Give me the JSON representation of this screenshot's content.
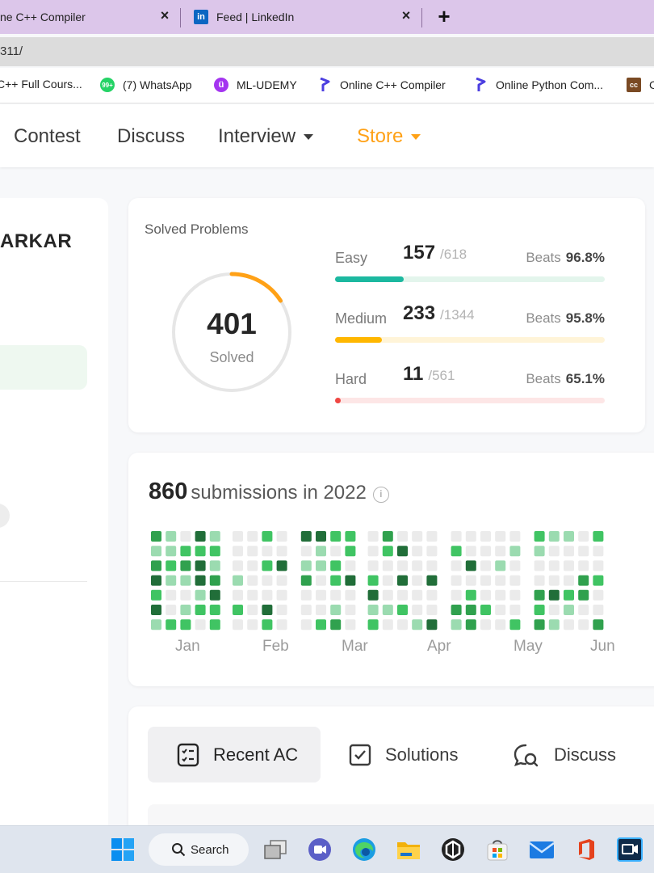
{
  "browser": {
    "tabs": [
      {
        "title": "ne C++ Compiler",
        "close": "×"
      },
      {
        "title": "Feed | LinkedIn",
        "close": "×",
        "icon": "in"
      }
    ],
    "new_tab": "+",
    "url": "311/",
    "bookmarks": [
      {
        "label": "C++ Full Cours..."
      },
      {
        "label": "(7) WhatsApp",
        "badge": "99+"
      },
      {
        "label": "ML-UDEMY",
        "badge": "ü"
      },
      {
        "label": "Online C++ Compiler"
      },
      {
        "label": "Online Python Com..."
      },
      {
        "label": "C",
        "badge": "cc"
      }
    ]
  },
  "nav": {
    "items": [
      {
        "label": "Contest"
      },
      {
        "label": "Discuss"
      },
      {
        "label": "Interview"
      },
      {
        "label": "Store"
      }
    ]
  },
  "profile": {
    "username": "ARKAR"
  },
  "solved": {
    "title": "Solved Problems",
    "total": "401",
    "total_label": "Solved",
    "total_fraction": 0.159,
    "difficulties": [
      {
        "name": "Easy",
        "count": "157",
        "total": "/618",
        "beats_label": "Beats",
        "beats": "96.8%",
        "fraction": 0.254,
        "color": "#1cb8a0",
        "track": "#e3f5ec"
      },
      {
        "name": "Medium",
        "count": "233",
        "total": "/1344",
        "beats_label": "Beats",
        "beats": "95.8%",
        "fraction": 0.173,
        "color": "#ffb700",
        "track": "#fff4d8"
      },
      {
        "name": "Hard",
        "count": "11",
        "total": "/561",
        "beats_label": "Beats",
        "beats": "65.1%",
        "fraction": 0.02,
        "color": "#ef4743",
        "track": "#fde6e6"
      }
    ],
    "ring_color": "#ffa116",
    "ring_track": "#e6e6e6"
  },
  "submissions": {
    "count": "860",
    "text": "submissions in 2022",
    "info_icon": "i",
    "months": [
      "Jan",
      "Feb",
      "Mar",
      "Apr",
      "May",
      "Jun"
    ],
    "heat_colors": [
      "#ebebeb",
      "#9bdbb0",
      "#40c463",
      "#30a14e",
      "#216e39"
    ]
  },
  "panel_tabs": [
    {
      "label": "Recent AC",
      "active": true
    },
    {
      "label": "Solutions",
      "active": false
    },
    {
      "label": "Discuss",
      "active": false
    }
  ],
  "taskbar": {
    "search_label": "Search"
  }
}
